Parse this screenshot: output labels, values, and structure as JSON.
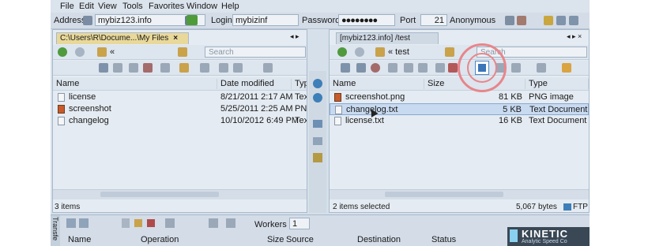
{
  "menu": [
    "File",
    "Edit",
    "View",
    "Tools",
    "Favorites",
    "Window",
    "Help"
  ],
  "address_bar": {
    "address_label": "Address",
    "address_value": "mybiz123.info",
    "login_label": "Login",
    "login_value": "mybizinf",
    "password_label": "Password",
    "password_value": "●●●●●●●●",
    "port_label": "Port",
    "port_value": "21",
    "anonymous_label": "Anonymous"
  },
  "left_pane": {
    "tab_label": "C:\\Users\\R\\Docume...\\My Files",
    "path_value": "«",
    "search_placeholder": "Search",
    "columns": [
      "Name",
      "Date modified",
      "Type"
    ],
    "rows": [
      {
        "name": "license",
        "date": "8/21/2011 2:17 AM",
        "type": "Text",
        "icon": "text"
      },
      {
        "name": "screenshot",
        "date": "5/25/2011 2:25 AM",
        "type": "PNG",
        "icon": "image"
      },
      {
        "name": "changelog",
        "date": "10/10/2012 6:49 PM",
        "type": "Text",
        "icon": "text"
      }
    ],
    "status": "3 items"
  },
  "right_pane": {
    "tab_label": "[mybiz123.info] /test",
    "path_value": "« test",
    "search_placeholder": "Search",
    "columns": [
      "Name",
      "Size",
      "Type"
    ],
    "rows": [
      {
        "name": "screenshot.png",
        "size": "81 KB",
        "type": "PNG image",
        "icon": "image",
        "selected": false
      },
      {
        "name": "changelog.txt",
        "size": "5 KB",
        "type": "Text Document",
        "icon": "text",
        "selected": true
      },
      {
        "name": "license.txt",
        "size": "16 KB",
        "type": "Text Document",
        "icon": "text",
        "selected": false
      }
    ],
    "status_left": "2 items selected",
    "status_bytes": "5,067",
    "status_bytes_label": "bytes",
    "status_protocol": "FTP"
  },
  "transfer": {
    "side_label": "Transfe",
    "workers_label": "Workers",
    "workers_value": "1",
    "columns": [
      "Name",
      "Operation",
      "Size",
      "Source",
      "Destination",
      "Status"
    ]
  },
  "watermark": {
    "brand": "KINETIC",
    "tagline": "Analytic Speed Co"
  },
  "colors": {
    "highlight_ring": "#e7868b",
    "active_tab": "#e8d89a",
    "selection": "#c8daf0"
  }
}
